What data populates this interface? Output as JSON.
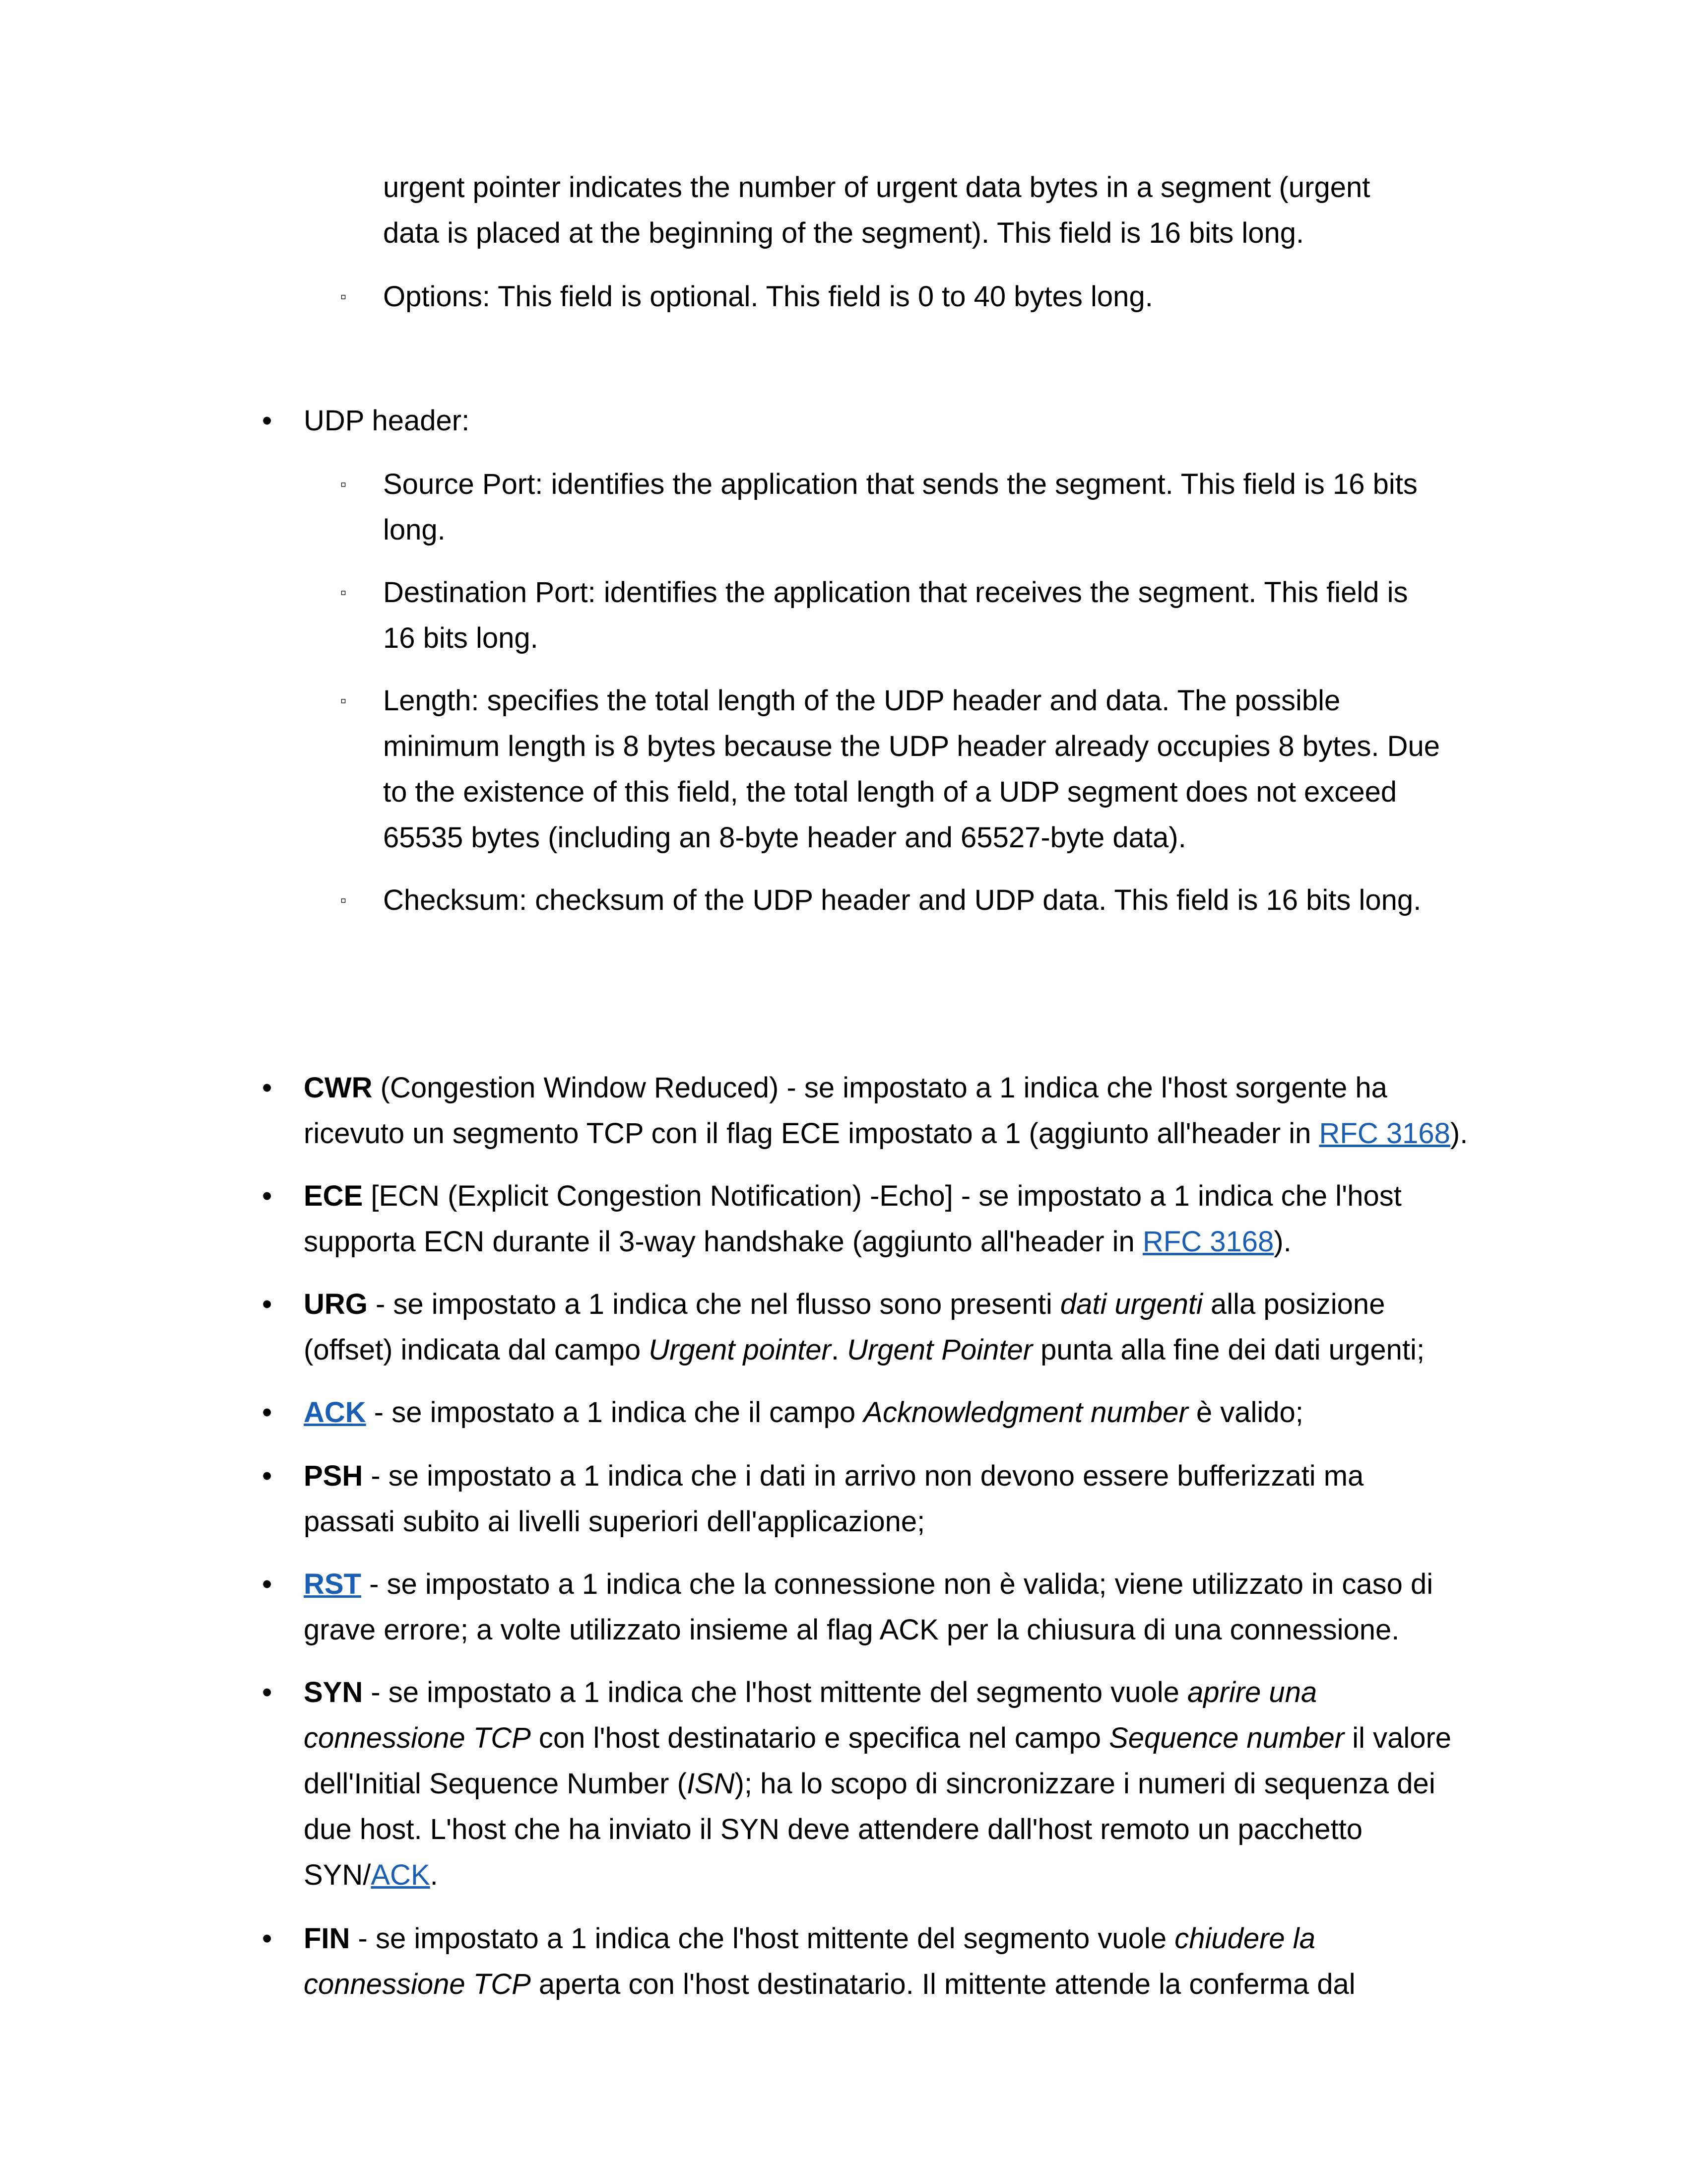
{
  "tcp_tail": {
    "line1": "urgent pointer indicates the number of urgent data bytes in a segment (urgent",
    "line2": "data is placed at the beginning of the segment). This field is 16 bits long.",
    "options": "Options: This field is optional. This field is 0 to 40 bytes long."
  },
  "udp": {
    "heading": "UDP header:",
    "items": [
      {
        "lines": [
          "Source Port: identifies the application that sends the segment. This field is 16 bits",
          "long."
        ]
      },
      {
        "lines": [
          "Destination Port: identifies the application that receives the segment. This field is",
          "16 bits long."
        ]
      },
      {
        "lines": [
          "Length: specifies the total length of the UDP header and data. The possible",
          "minimum length is 8 bytes because the UDP header already occupies 8 bytes. Due",
          "to the existence of this field, the total length of a UDP segment does not exceed",
          "65535 bytes (including an 8-byte header and 65527-byte data)."
        ]
      },
      {
        "lines": [
          "Checksum: checksum of the UDP header and UDP data. This field is 16 bits long."
        ]
      }
    ]
  },
  "flags": {
    "cwr": {
      "name": "CWR",
      "l1": " (Congestion Window Reduced) - se impostato a 1 indica che l'host sorgente ha",
      "l2a": "ricevuto un segmento TCP con il flag ECE impostato a 1 (aggiunto all'header in ",
      "link": "RFC 3168",
      "l2b": ")."
    },
    "ece": {
      "name": "ECE",
      "l1": " [ECN (Explicit Congestion Notification) -Echo] - se impostato a 1 indica che l'host",
      "l2a": "supporta ECN durante il 3-way handshake (aggiunto all'header in ",
      "link": "RFC 3168",
      "l2b": ")."
    },
    "urg": {
      "name": "URG",
      "l1a": " - se impostato a 1 indica che nel flusso sono presenti ",
      "l1i": "dati urgenti",
      "l1b": " alla posizione",
      "l2a": "(offset) indicata dal campo ",
      "l2i1": "Urgent pointer",
      "l2b": ". ",
      "l2i2": "Urgent Pointer",
      "l2c": " punta alla fine dei dati urgenti;"
    },
    "ack": {
      "name": "ACK",
      "l1a": " - se impostato a 1 indica che il campo ",
      "l1i": "Acknowledgment number",
      "l1b": " è valido;"
    },
    "psh": {
      "name": "PSH",
      "l1": " - se impostato a 1 indica che i dati in arrivo non devono essere bufferizzati ma",
      "l2": "passati subito ai livelli superiori dell'applicazione;"
    },
    "rst": {
      "name": "RST",
      "l1": " - se impostato a 1 indica che la connessione non è valida; viene utilizzato in caso di",
      "l2": "grave errore; a volte utilizzato insieme al flag ACK per la chiusura di una connessione."
    },
    "syn": {
      "name": "SYN",
      "l1a": " - se impostato a 1 indica che l'host mittente del segmento vuole ",
      "l1i": "aprire una",
      "l2i": "connessione TCP",
      "l2a": " con l'host destinatario e specifica nel campo ",
      "l2i2": "Sequence number",
      "l2b": " il valore",
      "l3a": "dell'Initial Sequence Number (",
      "l3i": "ISN",
      "l3b": "); ha lo scopo di sincronizzare i numeri di sequenza dei",
      "l4": "due host. L'host che ha inviato il SYN deve attendere dall'host remoto un pacchetto",
      "l5a": "SYN/",
      "l5link": "ACK",
      "l5b": "."
    },
    "fin": {
      "name": "FIN",
      "l1a": " - se impostato a 1 indica che l'host mittente del segmento vuole ",
      "l1i": "chiudere la",
      "l2i": "connessione TCP",
      "l2a": " aperta con l'host destinatario. Il mittente attende la conferma dal"
    }
  },
  "symbols": {
    "bullet": "•",
    "sub_bullet": "▫"
  }
}
